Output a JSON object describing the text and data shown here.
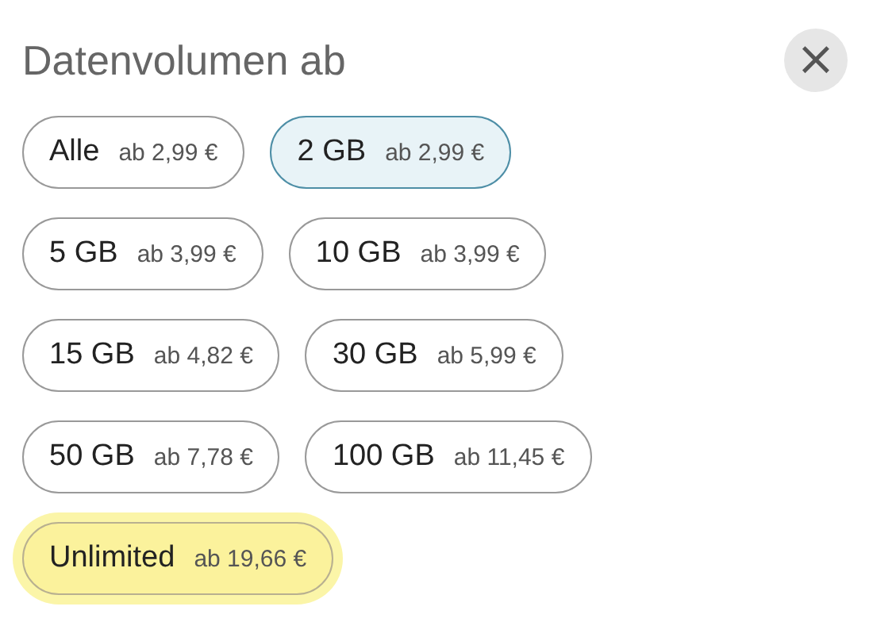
{
  "title": "Datenvolumen ab",
  "close_button": {
    "label": "×"
  },
  "option_rows": [
    [
      {
        "label": "Alle",
        "price": "ab 2,99 €",
        "selected": false,
        "highlighted": false
      },
      {
        "label": "2 GB",
        "price": "ab 2,99 €",
        "selected": true,
        "highlighted": false
      }
    ],
    [
      {
        "label": "5 GB",
        "price": "ab 3,99 €",
        "selected": false,
        "highlighted": false
      },
      {
        "label": "10 GB",
        "price": "ab 3,99 €",
        "selected": false,
        "highlighted": false
      }
    ],
    [
      {
        "label": "15 GB",
        "price": "ab 4,82 €",
        "selected": false,
        "highlighted": false
      },
      {
        "label": "30 GB",
        "price": "ab 5,99 €",
        "selected": false,
        "highlighted": false
      }
    ],
    [
      {
        "label": "50 GB",
        "price": "ab 7,78 €",
        "selected": false,
        "highlighted": false
      },
      {
        "label": "100 GB",
        "price": "ab 11,45 €",
        "selected": false,
        "highlighted": false
      }
    ],
    [
      {
        "label": "Unlimited",
        "price": "ab 19,66 €",
        "selected": false,
        "highlighted": true
      }
    ]
  ]
}
